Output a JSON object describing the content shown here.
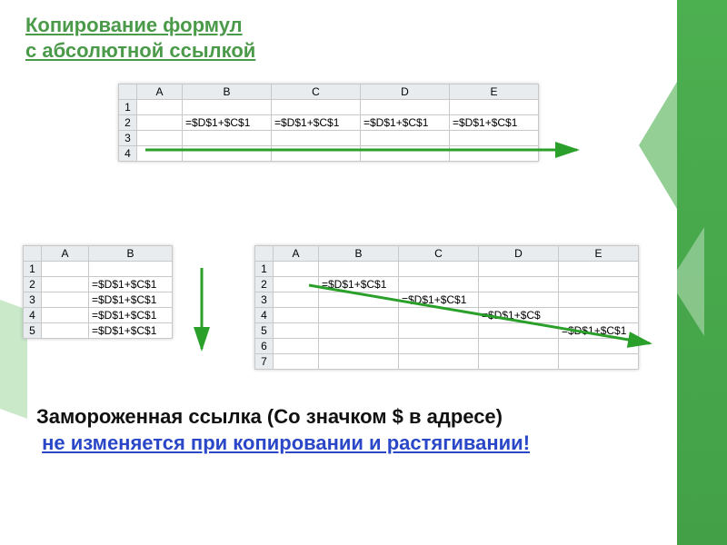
{
  "title_line1": "Копирование формул",
  "title_line2": "с абсолютной ссылкой",
  "formula": "=$D$1+$C$1",
  "sheet1": {
    "cols": [
      "A",
      "B",
      "C",
      "D",
      "E"
    ],
    "rows": [
      "1",
      "2",
      "3",
      "4"
    ],
    "cells": {
      "r2": [
        "",
        "=$D$1+$C$1",
        "=$D$1+$C$1",
        "=$D$1+$C$1",
        "=$D$1+$C$1"
      ]
    }
  },
  "sheet2": {
    "cols": [
      "A",
      "B"
    ],
    "rows": [
      "1",
      "2",
      "3",
      "4",
      "5"
    ],
    "cells": {
      "r2": [
        "",
        "=$D$1+$C$1"
      ],
      "r3": [
        "",
        "=$D$1+$C$1"
      ],
      "r4": [
        "",
        "=$D$1+$C$1"
      ],
      "r5": [
        "",
        "=$D$1+$C$1"
      ]
    }
  },
  "sheet3": {
    "cols": [
      "A",
      "B",
      "C",
      "D",
      "E"
    ],
    "rows": [
      "1",
      "2",
      "3",
      "4",
      "5",
      "6",
      "7"
    ],
    "cells": {
      "r2": [
        "",
        "=$D$1+$C$1",
        "",
        "",
        ""
      ],
      "r3": [
        "",
        "",
        "=$D$1+$C$1",
        "",
        ""
      ],
      "r4": [
        "",
        "",
        "",
        "=$D$1+$C$",
        ""
      ],
      "r5": [
        "",
        "",
        "",
        "",
        "=$D$1+$C$1"
      ]
    }
  },
  "explain": {
    "p1a": "Замороженная ссылка (Со значком $ в адресе)",
    "p2_ul": "не изменяется при копировании и растягивании!"
  }
}
